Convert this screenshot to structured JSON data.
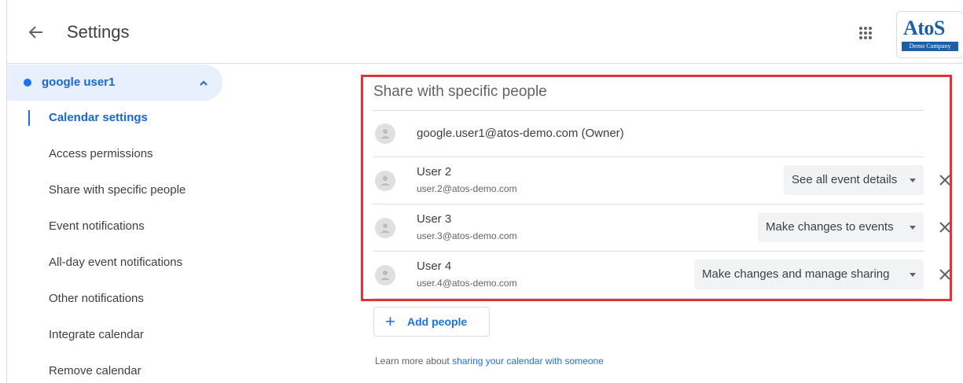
{
  "header": {
    "title": "Settings",
    "logo_main": "AtoS",
    "logo_sub": "Demo Company"
  },
  "sidebar": {
    "account": "google user1",
    "items": [
      {
        "label": "Calendar settings",
        "active": true
      },
      {
        "label": "Access permissions",
        "active": false
      },
      {
        "label": "Share with specific people",
        "active": false
      },
      {
        "label": "Event notifications",
        "active": false
      },
      {
        "label": "All-day event notifications",
        "active": false
      },
      {
        "label": "Other notifications",
        "active": false
      },
      {
        "label": "Integrate calendar",
        "active": false
      },
      {
        "label": "Remove calendar",
        "active": false
      }
    ]
  },
  "share": {
    "title": "Share with specific people",
    "owner": "google.user1@atos-demo.com (Owner)",
    "users": [
      {
        "name": "User 2",
        "email": "user.2@atos-demo.com",
        "permission": "See all event details"
      },
      {
        "name": "User 3",
        "email": "user.3@atos-demo.com",
        "permission": "Make changes to events"
      },
      {
        "name": "User 4",
        "email": "user.4@atos-demo.com",
        "permission": "Make changes and manage sharing"
      }
    ],
    "add_people_label": "Add people",
    "add_icon": "+",
    "learn_more_prefix": "Learn more about ",
    "learn_more_link": "sharing your calendar with someone"
  },
  "colors": {
    "accent": "#1a73e8",
    "highlight": "#e2323a",
    "selected_bg": "#e8f0fe"
  }
}
